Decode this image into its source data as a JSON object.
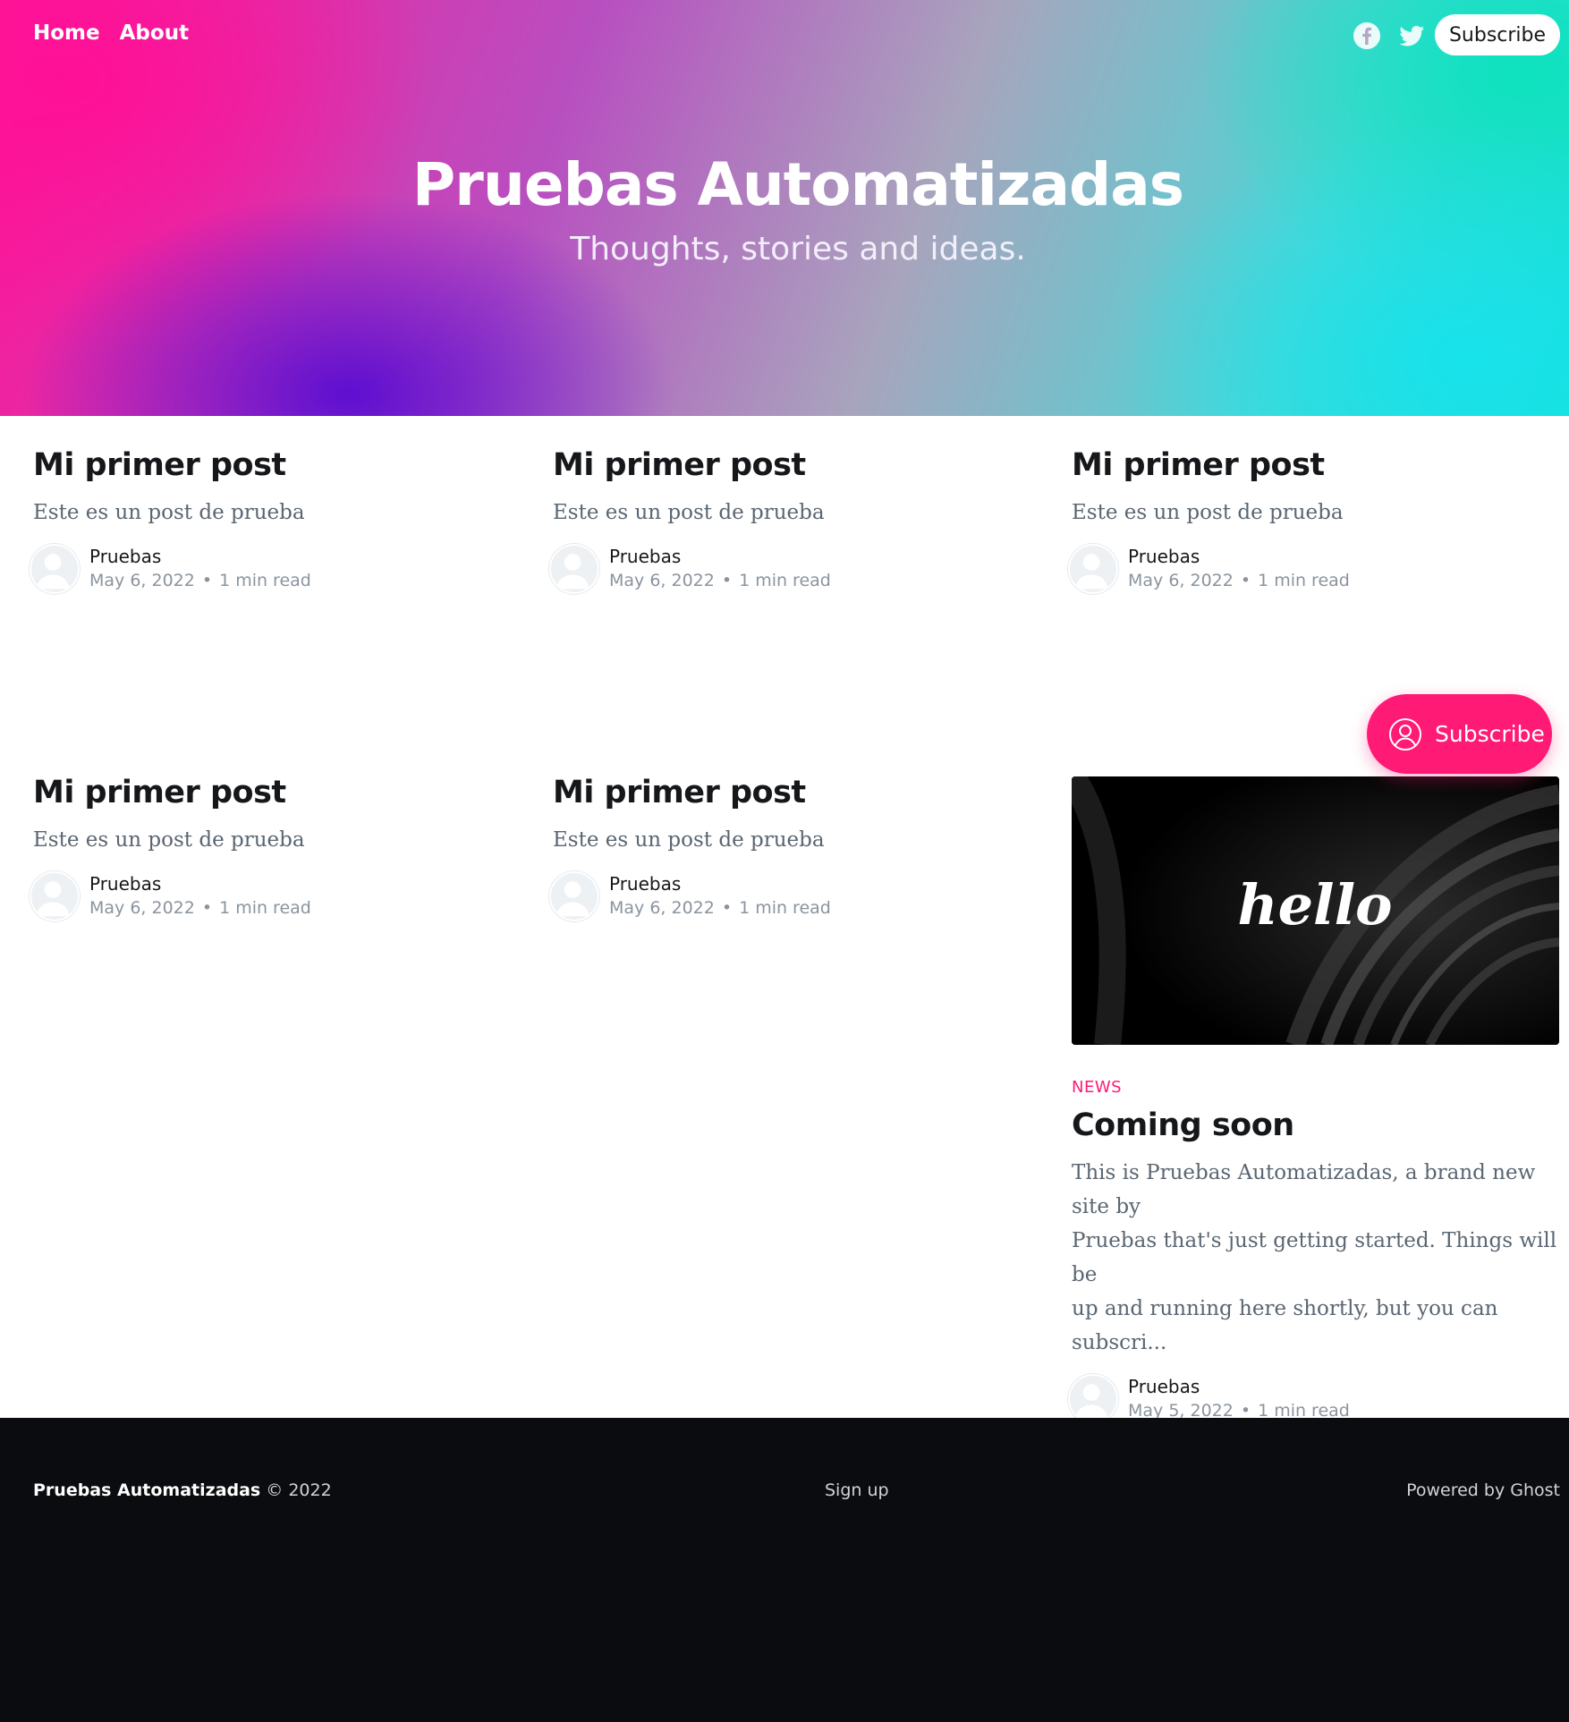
{
  "nav": {
    "home": "Home",
    "about": "About"
  },
  "header": {
    "subscribe_label": "Subscribe",
    "social": [
      "facebook-icon",
      "twitter-icon"
    ]
  },
  "hero": {
    "title": "Pruebas Automatizadas",
    "description": "Thoughts, stories and ideas."
  },
  "posts": [
    {
      "title": "Mi primer post",
      "excerpt": "Este es un post de prueba",
      "author": "Pruebas",
      "date": "May 6, 2022",
      "read_time": "1 min read"
    },
    {
      "title": "Mi primer post",
      "excerpt": "Este es un post de prueba",
      "author": "Pruebas",
      "date": "May 6, 2022",
      "read_time": "1 min read"
    },
    {
      "title": "Mi primer post",
      "excerpt": "Este es un post de prueba",
      "author": "Pruebas",
      "date": "May 6, 2022",
      "read_time": "1 min read"
    },
    {
      "title": "Mi primer post",
      "excerpt": "Este es un post de prueba",
      "author": "Pruebas",
      "date": "May 6, 2022",
      "read_time": "1 min read"
    },
    {
      "title": "Mi primer post",
      "excerpt": "Este es un post de prueba",
      "author": "Pruebas",
      "date": "May 6, 2022",
      "read_time": "1 min read"
    }
  ],
  "featured": {
    "image_text": "hello",
    "tag": "NEWS",
    "title": "Coming soon",
    "excerpt_lines": [
      "This is Pruebas Automatizadas, a brand new site by",
      "Pruebas that's just getting started. Things will be",
      "up and running here shortly, but you can subscri..."
    ],
    "author": "Pruebas",
    "date": "May 5, 2022",
    "read_time": "1 min read"
  },
  "floating": {
    "subscribe_label": "Subscribe"
  },
  "footer": {
    "site_name": "Pruebas Automatizadas",
    "copyright": "© 2022",
    "signup": "Sign up",
    "powered": "Powered by Ghost"
  },
  "colors": {
    "accent": "#ff1a75",
    "footer_bg": "#0b0c0f",
    "excerpt": "#5a6672",
    "meta": "#8a949e"
  }
}
